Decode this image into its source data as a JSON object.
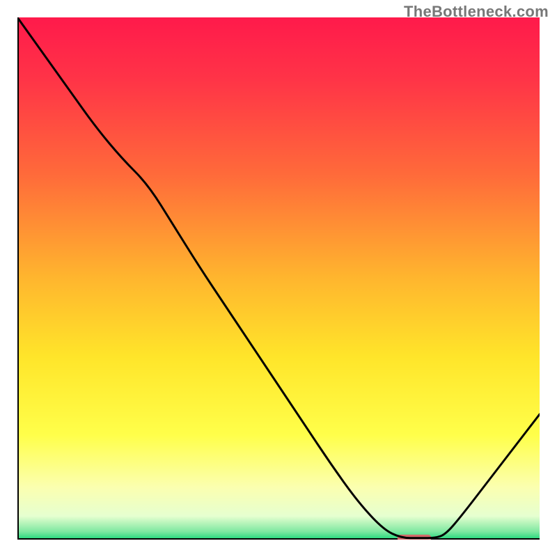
{
  "watermark": "TheBottleneck.com",
  "chart_data": {
    "type": "line",
    "title": "",
    "xlabel": "",
    "ylabel": "",
    "xlim": [
      0,
      100
    ],
    "ylim": [
      0,
      100
    ],
    "grid": false,
    "series": [
      {
        "name": "bottleneck-curve",
        "x": [
          0,
          5,
          10,
          15,
          20,
          25,
          30,
          35,
          40,
          45,
          50,
          55,
          60,
          65,
          70,
          73.5,
          77,
          80,
          82,
          85,
          90,
          95,
          100
        ],
        "y": [
          100,
          93,
          86,
          79,
          73,
          68,
          60,
          52,
          44.5,
          37,
          29.5,
          22,
          14.5,
          7.5,
          2.0,
          0.3,
          0.3,
          0.3,
          1.0,
          4.5,
          11,
          17.5,
          24
        ]
      }
    ],
    "marker": {
      "name": "highlight-range",
      "x_center": 76,
      "y": 0.35,
      "width": 6.5,
      "color": "#d46a6a"
    },
    "background_gradient": {
      "stops": [
        {
          "offset": 0.0,
          "color": "#ff1a4b"
        },
        {
          "offset": 0.12,
          "color": "#ff3447"
        },
        {
          "offset": 0.3,
          "color": "#ff6a3a"
        },
        {
          "offset": 0.5,
          "color": "#ffb62e"
        },
        {
          "offset": 0.65,
          "color": "#ffe52a"
        },
        {
          "offset": 0.8,
          "color": "#ffff4a"
        },
        {
          "offset": 0.9,
          "color": "#fbffb0"
        },
        {
          "offset": 0.955,
          "color": "#e6ffd0"
        },
        {
          "offset": 0.985,
          "color": "#7de8a0"
        },
        {
          "offset": 1.0,
          "color": "#1ed77a"
        }
      ]
    },
    "axis_color": "#000000",
    "line_color": "#000000",
    "line_width": 3
  }
}
